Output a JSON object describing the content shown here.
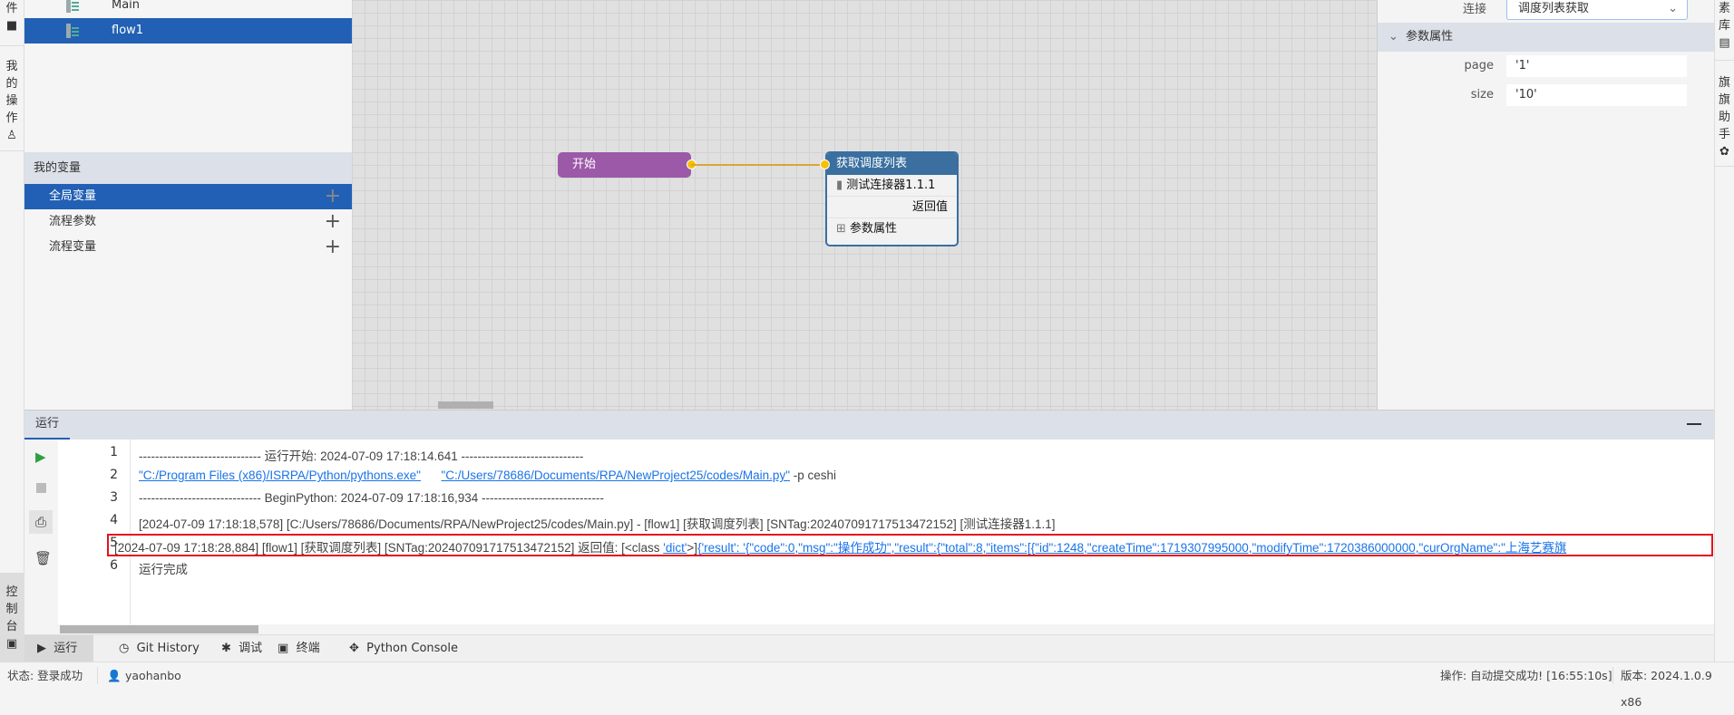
{
  "left_strip": {
    "top_label": "件",
    "ops_label": "我的操作",
    "console_label": "控制台"
  },
  "right_strip": {
    "lib_label": "素库",
    "assistant_label": "旗旗助手"
  },
  "tree": {
    "items": [
      {
        "label": "Main",
        "selected": false
      },
      {
        "label": "flow1",
        "selected": true
      }
    ]
  },
  "variables": {
    "header": "我的变量",
    "items": [
      {
        "label": "全局变量",
        "selected": true
      },
      {
        "label": "流程参数",
        "selected": false
      },
      {
        "label": "流程变量",
        "selected": false
      }
    ]
  },
  "canvas": {
    "start_node": {
      "label": "开始",
      "color": "#9b59a8"
    },
    "action_node": {
      "title": "获取调度列表",
      "connector": "测试连接器1.1.1",
      "return_label": "返回值",
      "params_label": "参数属性",
      "color": "#3a6fa0"
    }
  },
  "properties": {
    "connection_label": "连接",
    "connection_value": "调度列表获取",
    "params_header": "参数属性",
    "params": [
      {
        "name": "page",
        "value": "'1'"
      },
      {
        "name": "size",
        "value": "'10'"
      }
    ]
  },
  "run_panel": {
    "title": "运行",
    "lines": [
      {
        "n": "1",
        "text": "------------------------------ 运行开始: 2024-07-09 17:18:14.641 ------------------------------"
      },
      {
        "n": "2",
        "link1": "\"C:/Program Files (x86)/ISRPA/Python/pythons.exe\"",
        "link2": "\"C:/Users/78686/Documents/RPA/NewProject25/codes/Main.py\"",
        "rest": " -p  ceshi"
      },
      {
        "n": "3",
        "text": "------------------------------ BeginPython: 2024-07-09 17:18:16,934 ------------------------------"
      },
      {
        "n": "4",
        "text": "[2024-07-09 17:18:18,578] [C:/Users/78686/Documents/RPA/NewProject25/codes/Main.py] - [flow1] [获取调度列表] [SNTag:20240709171751347215​2] [测试连接器1.1.1]"
      },
      {
        "n": "5",
        "prefix": "[2024-07-09 17:18:28,884] [flow1] [获取调度列表] [SNTag:202407091717513472152]  返回值:  [<class ",
        "dict": "'dict'",
        ">]": ">]",
        "payload": "{'result': '{\"code\":0,\"msg\":\"操作成功\",\"result\":{\"total\":8,\"items\":[{\"id\":1248,\"createTime\":1719307995000,\"modifyTime\":1720386000000,\"curOrgName\":\"上海艺赛旗"
      },
      {
        "n": "6",
        "text": "运行完成"
      }
    ]
  },
  "bottom_tabs": [
    {
      "label": "运行",
      "active": true
    },
    {
      "label": "Git History"
    },
    {
      "label": "调试"
    },
    {
      "label": "终端"
    },
    {
      "label": "Python Console"
    }
  ],
  "status_bar": {
    "status": "状态: 登录成功",
    "user": "yaohanbo",
    "operation": "操作:  自动提交成功!  [16:55:10s]",
    "version": "版本:  2024.1.0.9 x86"
  }
}
